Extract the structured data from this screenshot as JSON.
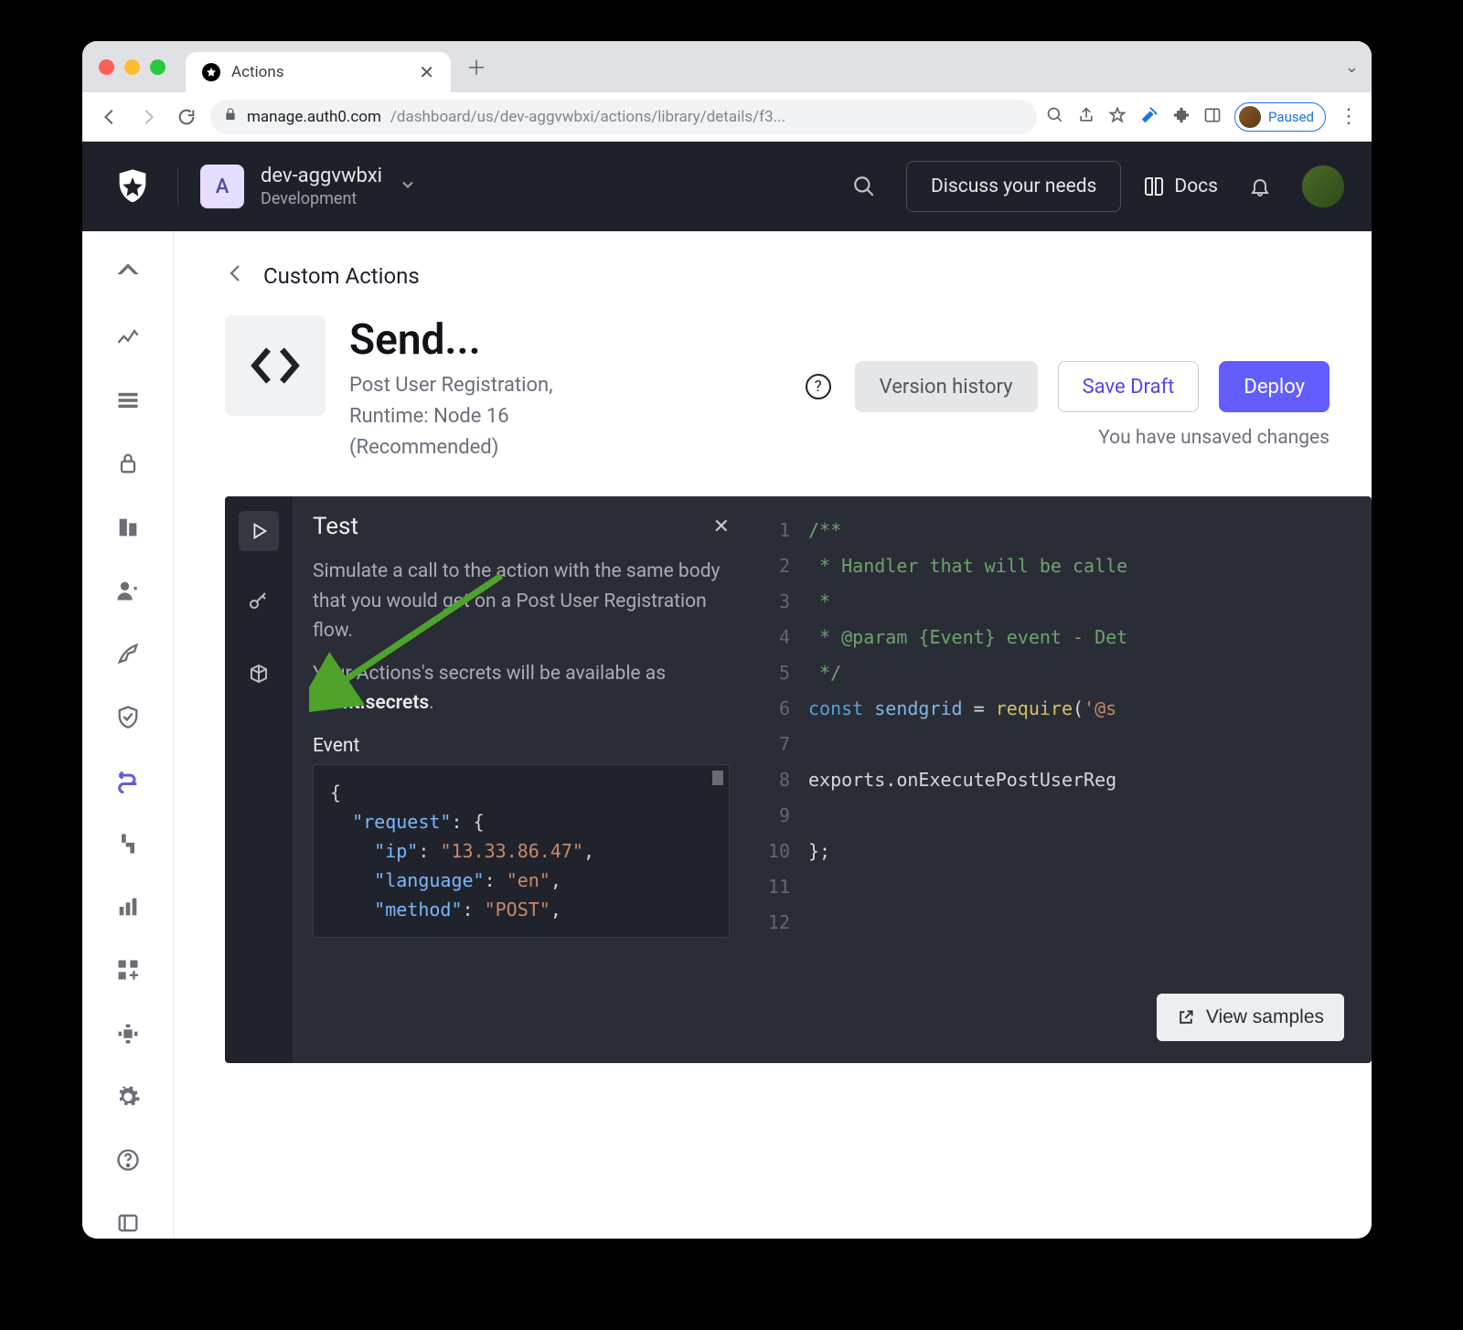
{
  "browser": {
    "tab_title": "Actions",
    "url_host": "manage.auth0.com",
    "url_path": "/dashboard/us/dev-aggvwbxi/actions/library/details/f3...",
    "profile_label": "Paused"
  },
  "header": {
    "tenant_initial": "A",
    "tenant_name": "dev-aggvwbxi",
    "tenant_env": "Development",
    "discuss_label": "Discuss your needs",
    "docs_label": "Docs"
  },
  "crumb": {
    "label": "Custom Actions"
  },
  "action": {
    "title": "Send...",
    "subtitle_line1": "Post User Registration,",
    "subtitle_line2": "Runtime: Node 16 (Recommended)",
    "version_history": "Version history",
    "save_draft": "Save Draft",
    "deploy": "Deploy",
    "unsaved": "You have unsaved changes"
  },
  "test_panel": {
    "title": "Test",
    "desc1": "Simulate a call to the action with the same body that you would get on a Post User Registration flow.",
    "desc2_prefix": "Your Actions's secrets will be available as ",
    "desc2_bold": "event.secrets",
    "desc2_suffix": ".",
    "event_label": "Event",
    "json": {
      "lines": [
        {
          "indent": 0,
          "tokens": [
            {
              "t": "brace",
              "v": "{"
            }
          ]
        },
        {
          "indent": 1,
          "tokens": [
            {
              "t": "key",
              "v": "\"request\""
            },
            {
              "t": "punct",
              "v": ": {"
            }
          ]
        },
        {
          "indent": 2,
          "tokens": [
            {
              "t": "key",
              "v": "\"ip\""
            },
            {
              "t": "punct",
              "v": ": "
            },
            {
              "t": "str",
              "v": "\"13.33.86.47\""
            },
            {
              "t": "punct",
              "v": ","
            }
          ]
        },
        {
          "indent": 2,
          "tokens": [
            {
              "t": "key",
              "v": "\"language\""
            },
            {
              "t": "punct",
              "v": ": "
            },
            {
              "t": "str",
              "v": "\"en\""
            },
            {
              "t": "punct",
              "v": ","
            }
          ]
        },
        {
          "indent": 2,
          "tokens": [
            {
              "t": "key",
              "v": "\"method\""
            },
            {
              "t": "punct",
              "v": ": "
            },
            {
              "t": "str",
              "v": "\"POST\""
            },
            {
              "t": "punct",
              "v": ","
            }
          ]
        }
      ]
    }
  },
  "code": {
    "line_numbers": [
      "1",
      "2",
      "3",
      "4",
      "5",
      "6",
      "7",
      "8",
      "9",
      "10",
      "11",
      "12"
    ],
    "lines": [
      [
        {
          "c": "c-comment",
          "v": "/**"
        }
      ],
      [
        {
          "c": "c-comment",
          "v": " * Handler that will be calle"
        }
      ],
      [
        {
          "c": "c-comment",
          "v": " *"
        }
      ],
      [
        {
          "c": "c-comment",
          "v": " * @param {Event} event - Det"
        }
      ],
      [
        {
          "c": "c-comment",
          "v": " */"
        }
      ],
      [
        {
          "c": "c-kw",
          "v": "const"
        },
        {
          "c": "c-plain",
          "v": " "
        },
        {
          "c": "c-id",
          "v": "sendgrid"
        },
        {
          "c": "c-plain",
          "v": " = "
        },
        {
          "c": "c-fn",
          "v": "require"
        },
        {
          "c": "c-plain",
          "v": "("
        },
        {
          "c": "c-str",
          "v": "'@s"
        }
      ],
      [
        {
          "c": "c-plain",
          "v": ""
        }
      ],
      [
        {
          "c": "c-plain",
          "v": "exports.onExecutePostUserReg"
        }
      ],
      [
        {
          "c": "c-plain",
          "v": ""
        }
      ],
      [
        {
          "c": "c-plain",
          "v": "};"
        }
      ],
      [
        {
          "c": "c-plain",
          "v": ""
        }
      ],
      [
        {
          "c": "c-plain",
          "v": ""
        }
      ]
    ],
    "view_samples": "View samples"
  }
}
